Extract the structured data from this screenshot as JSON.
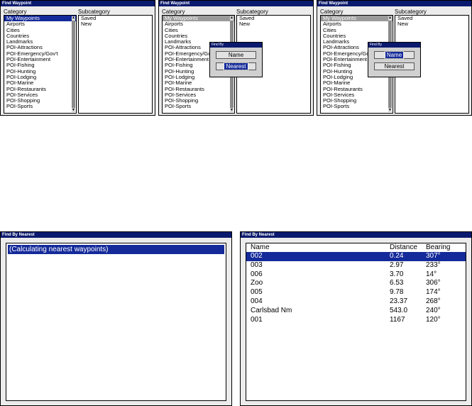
{
  "find_waypoint": {
    "title": "Find Waypoint",
    "category_header": "Category",
    "subcategory_header": "Subcategory",
    "categories": [
      "My Waypoints",
      "Airports",
      "Cities",
      "Countries",
      "Landmarks",
      "POI-Attractions",
      "POI-Emergency/Gov't",
      "POI-Entertainment",
      "POI-Fishing",
      "POI-Hunting",
      "POI-Lodging",
      "POI-Marine",
      "POI-Restaurants",
      "POI-Services",
      "POI-Shopping",
      "POI-Sports"
    ],
    "subcategories": [
      "Saved",
      "New"
    ]
  },
  "find_by_popup": {
    "title": "Find By",
    "name_label": "Name",
    "nearest_label": "Nearest"
  },
  "find_by_nearest": {
    "title": "Find By Nearest",
    "calculating_text": "(Calculating nearest waypoints)",
    "columns": {
      "name": "Name",
      "distance": "Distance",
      "bearing": "Bearing"
    },
    "rows": [
      {
        "name": "002",
        "distance": "0.24",
        "bearing": "307°"
      },
      {
        "name": "003",
        "distance": "2.97",
        "bearing": "233°"
      },
      {
        "name": "006",
        "distance": "3.70",
        "bearing": "14°"
      },
      {
        "name": "Zoo",
        "distance": "6.53",
        "bearing": "306°"
      },
      {
        "name": "005",
        "distance": "9.78",
        "bearing": "174°"
      },
      {
        "name": "004",
        "distance": "23.37",
        "bearing": "268°"
      },
      {
        "name": "Carlsbad Nm",
        "distance": "543.0",
        "bearing": "240°"
      },
      {
        "name": "001",
        "distance": "1167",
        "bearing": "120°"
      }
    ]
  },
  "colors": {
    "selection": "#142a9a",
    "titlebar": "#0a1a6e"
  }
}
